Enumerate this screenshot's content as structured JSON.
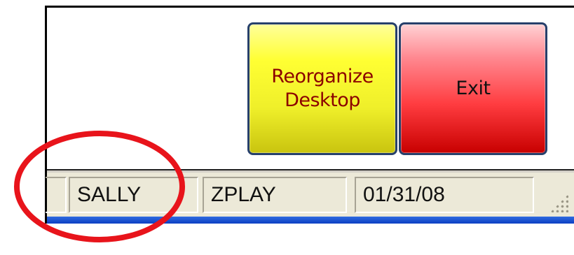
{
  "buttons": {
    "reorganize_label": "Reorganize\nDesktop",
    "exit_label": "Exit"
  },
  "statusbar": {
    "panel_user": "SALLY",
    "panel_workstation": "ZPLAY",
    "panel_date": "01/31/08"
  },
  "colors": {
    "reorganize_fill": "#ffff33",
    "reorganize_text": "#8b0000",
    "exit_fill": "#ff3c40",
    "exit_text": "#111111",
    "button_border": "#27406b",
    "statusbar_bg": "#ece9d8",
    "taskbar_accent": "#0c3fc3",
    "annotation_ring": "#e8141b"
  },
  "icons": {
    "resize_grip": "size-grip-icon",
    "annotation": "highlight-ellipse"
  }
}
